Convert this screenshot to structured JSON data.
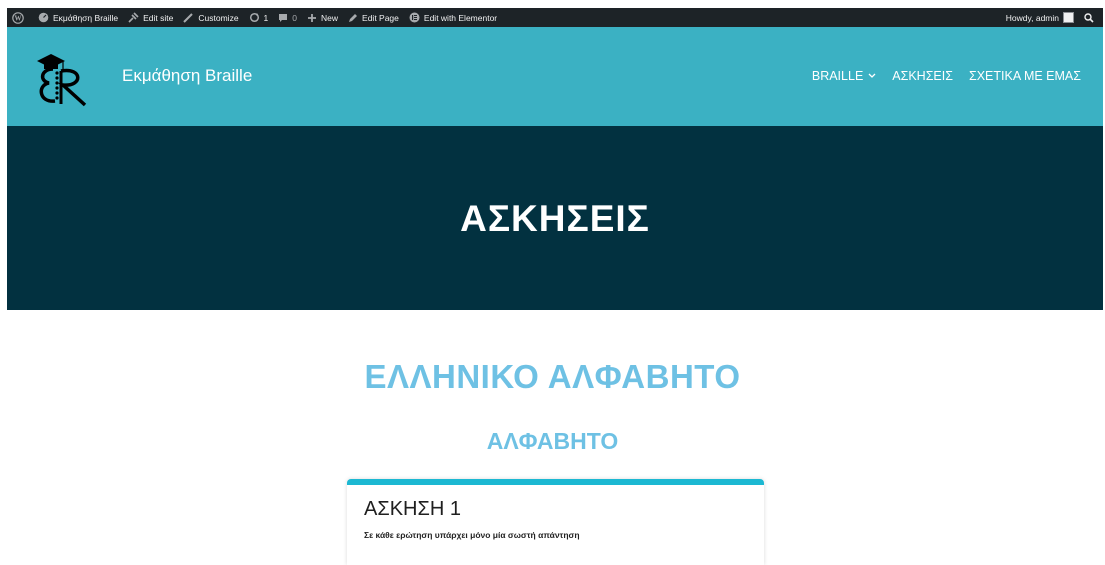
{
  "adminbar": {
    "site_name": "Εκμάθηση Braille",
    "edit_site": "Edit site",
    "customize": "Customize",
    "updates_count": "1",
    "comments_count": "0",
    "new_label": "New",
    "edit_page": "Edit Page",
    "edit_elementor": "Edit with Elementor",
    "howdy": "Howdy, admin"
  },
  "header": {
    "site_title": "Εκμάθηση Braille",
    "nav": [
      "BRAILLE",
      "ΑΣΚΗΣΕΙΣ",
      "ΣΧΕΤΙΚΑ ΜΕ ΕΜΑΣ"
    ]
  },
  "hero": {
    "title": "ΑΣΚΗΣΕΙΣ"
  },
  "content": {
    "heading": "ΕΛΛΗΝΙΚΟ ΑΛΦΑΒΗΤΟ",
    "subheading": "ΑΛΦΑΒΗΤΟ",
    "card_title": "ΑΣΚΗΣΗ 1",
    "card_text": "Σε κάθε ερώτηση υπάρχει μόνο μία σωστή απάντηση"
  },
  "colors": {
    "adminbar": "#1d2327",
    "header": "#3bb1c3",
    "hero": "#023140",
    "accent": "#6ec1e4",
    "card_border": "#1cb8d2"
  },
  "icons": [
    "wordpress-icon",
    "dashboard-icon",
    "edit-site-icon",
    "customize-icon",
    "updates-icon",
    "comments-icon",
    "plus-icon",
    "edit-page-icon",
    "elementor-icon",
    "search-icon",
    "chevron-down-icon"
  ]
}
